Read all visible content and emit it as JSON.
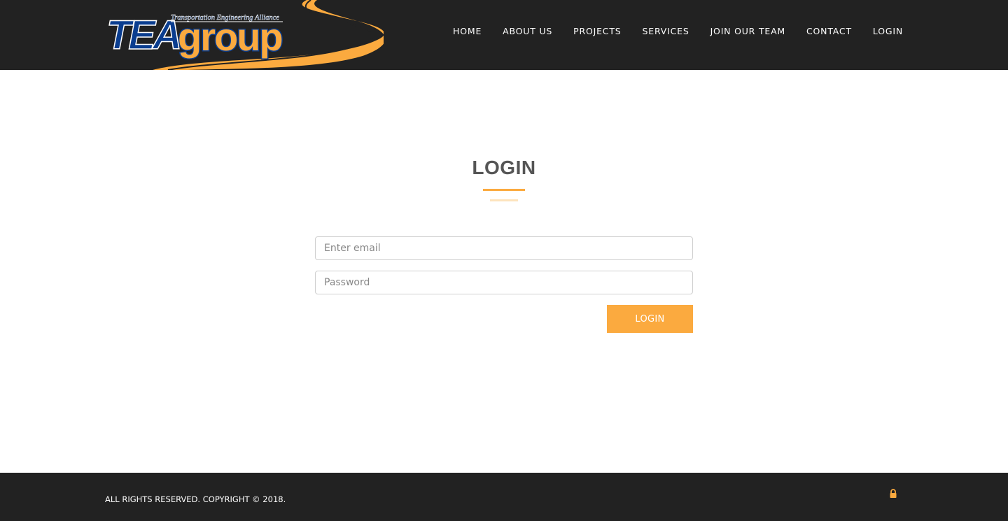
{
  "brand": {
    "logo_main_1": "TEA",
    "logo_main_2": "group",
    "logo_tagline": "Transportation Engineering Alliance"
  },
  "nav": {
    "items": [
      {
        "label": "HOME"
      },
      {
        "label": "ABOUT US"
      },
      {
        "label": "PROJECTS"
      },
      {
        "label": "SERVICES"
      },
      {
        "label": "JOIN OUR TEAM"
      },
      {
        "label": "CONTACT"
      },
      {
        "label": "LOGIN"
      }
    ]
  },
  "login": {
    "title": "LOGIN",
    "email_placeholder": "Enter email",
    "password_placeholder": "Password",
    "submit_label": "LOGIN"
  },
  "footer": {
    "copyright": "ALL RIGHTS RESERVED. COPYRIGHT © 2018."
  },
  "icons": {
    "footer_icon": "lock-icon"
  },
  "colors": {
    "header_bg": "#222222",
    "accent": "#fbaa3f",
    "accent_light": "#fde3bd",
    "logo_blue": "#0a3d8f",
    "title_text": "#555555"
  }
}
